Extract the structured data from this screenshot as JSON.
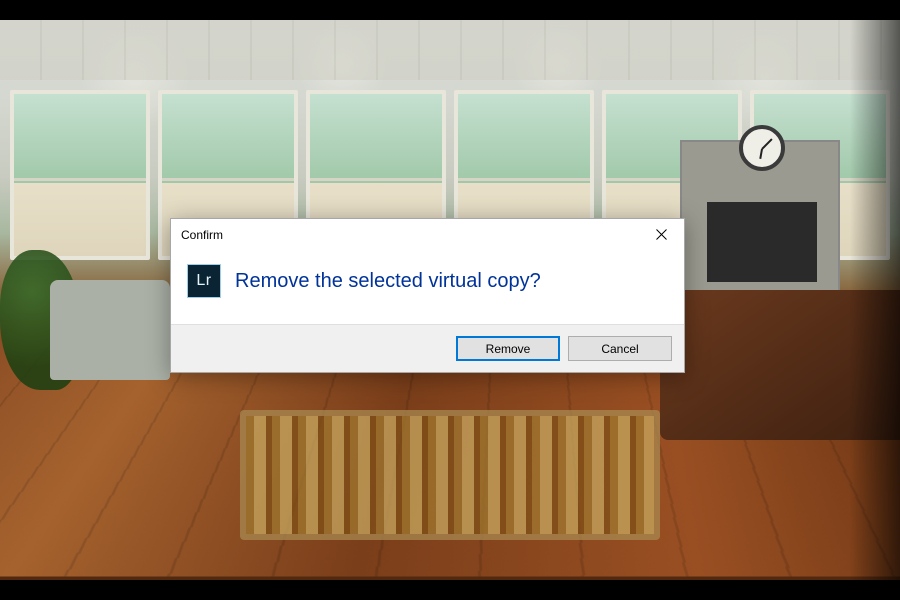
{
  "dialog": {
    "title": "Confirm",
    "icon_label": "Lr",
    "message": "Remove the selected virtual copy?",
    "primary_button": "Remove",
    "cancel_button": "Cancel"
  }
}
